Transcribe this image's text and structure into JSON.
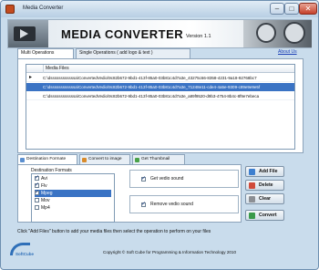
{
  "window": {
    "title": "Media Converter"
  },
  "banner": {
    "title": "MEDIA CONVERTER",
    "version": "Version 1.1",
    "about": "About Us"
  },
  "top_tabs": [
    {
      "label": "Multi Operations"
    },
    {
      "label": "Single Operations ( add logo & text )"
    }
  ],
  "media_list": {
    "header": "Media Files",
    "rows": [
      {
        "path": "C:\\dssssssssssssa\\ConvertedVedio\\9c82b672-9bd1-413f-85a0-03b81c4d7a3e_43275c66-8358-4231-9a18-92768bc7"
      },
      {
        "path": "C:\\dssssssssssssa\\ConvertedVedio\\9c82b672-9bd1-413f-85a0-03b81c4d7a3e_71248e11-cde4-4a5e-9309-c89e9e9e5f"
      },
      {
        "path": "C:\\dssssssssssssa\\ConvertedVedio\\9c82b672-9bd1-413f-85a0-03b81c4d7a3e_a89f9520-d9b3-4754-8b4c-8f9e7ebeca"
      }
    ]
  },
  "bottom_tabs": [
    {
      "label": "Destination Formate"
    },
    {
      "label": "Convert to image"
    },
    {
      "label": "Get Thumbnail"
    }
  ],
  "destination": {
    "label": "Destination Formats",
    "formats": [
      {
        "name": "Avi",
        "checked": true
      },
      {
        "name": "Flv",
        "checked": true
      },
      {
        "name": "Mpeg",
        "checked": true
      },
      {
        "name": "Mov",
        "checked": false
      },
      {
        "name": "Mp4",
        "checked": false
      }
    ],
    "get_vedio_sound": "Get vedio sound",
    "remove_vedio_sound": "Remove vedio sound"
  },
  "buttons": {
    "add_file": "Add File",
    "delete": "Delete",
    "clear": "Clear",
    "convert": "Convert"
  },
  "hint": "Click \"Add Files\" button to add your media files  then  select the operation to perform on your files",
  "footer": {
    "logo_text": "SoftCube",
    "copyright": "Copyright © Soft Cube for Programming & Information Technology 2010"
  },
  "colors": {
    "selection": "#3a73c4",
    "window_bg": "#c9dcec",
    "link": "#1a3fb5"
  }
}
